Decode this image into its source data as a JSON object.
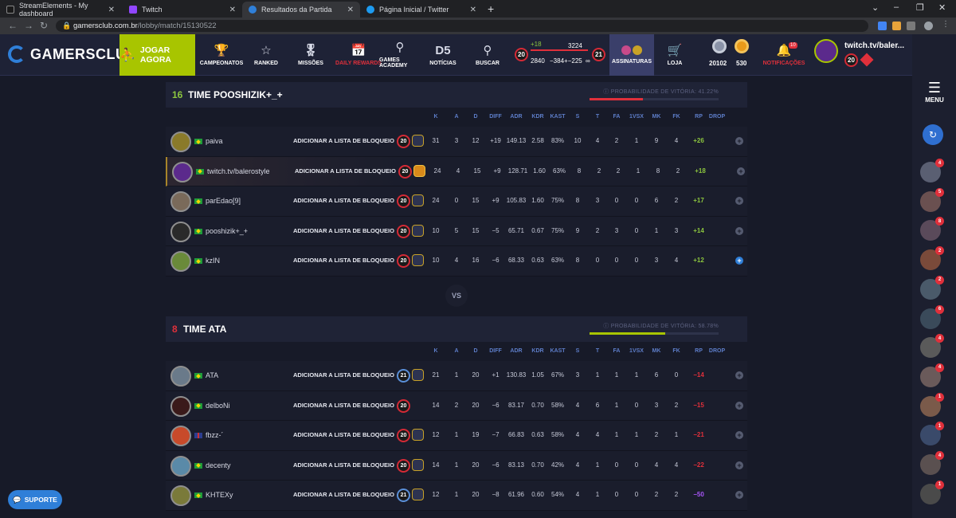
{
  "browser": {
    "tabs": [
      {
        "title": "StreamElements - My dashboard",
        "active": false
      },
      {
        "title": "Twitch",
        "active": false
      },
      {
        "title": "Resultados da Partida",
        "active": true
      },
      {
        "title": "Página Inicial / Twitter",
        "active": false
      }
    ],
    "url_host": "gamersclub.com.br",
    "url_path": "/lobby/match/15130522"
  },
  "header": {
    "logo": "GAMERSCLUB",
    "play": "JOGAR AGORA",
    "nav": [
      "CAMPEONATOS",
      "RANKED",
      "MISSÕES",
      "DAILY REWARDS",
      "GAMES ACADEMY",
      "NOTÍCIAS",
      "BUSCAR"
    ],
    "level": {
      "left": "20",
      "right": "21",
      "gain": "+18",
      "current": "2840",
      "target": "3224",
      "range": "−384+−225",
      "infinity": "∞"
    },
    "subs": "ASSINATURAS",
    "shop": "LOJA",
    "coins1": "20102",
    "coins2": "530",
    "notif": "NOTIFICAÇÕES",
    "notif_badge": "10",
    "user": {
      "name": "twitch.tv/baler...",
      "level": "20"
    }
  },
  "sidebar": {
    "menu": "MENU",
    "friend_counts": [
      "4",
      "5",
      "8",
      "2",
      "2",
      "6",
      "4",
      "4",
      "1",
      "1",
      "4",
      "1"
    ]
  },
  "columns": [
    "K",
    "A",
    "D",
    "DIFF",
    "ADR",
    "KDR",
    "KAST",
    "S",
    "T",
    "FA",
    "1VSX",
    "MK",
    "FK",
    "RP",
    "DROP"
  ],
  "block_label": "ADICIONAR A LISTA DE BLOQUEIO",
  "vs": "VS",
  "support": "SUPORTE",
  "team1": {
    "score": "16",
    "name": "TIME POOSHIZIK+_+",
    "prob_label": "PROBABILIDADE DE VITÓRIA: 41.22%",
    "prob": 0.4122,
    "players": [
      {
        "name": "paiva",
        "lvl": "20",
        "stats": [
          "31",
          "3",
          "12",
          "+19",
          "149.13",
          "2.58",
          "83%",
          "10",
          "4",
          "2",
          "1",
          "9",
          "4",
          "+26"
        ],
        "drop": false
      },
      {
        "name": "twitch.tv/balerostyle",
        "lvl": "20",
        "stats": [
          "24",
          "4",
          "15",
          "+9",
          "128.71",
          "1.60",
          "63%",
          "8",
          "2",
          "2",
          "1",
          "8",
          "2",
          "+18"
        ],
        "drop": false
      },
      {
        "name": "parEdao[9]",
        "lvl": "20",
        "stats": [
          "24",
          "0",
          "15",
          "+9",
          "105.83",
          "1.60",
          "75%",
          "8",
          "3",
          "0",
          "0",
          "6",
          "2",
          "+17"
        ],
        "drop": false
      },
      {
        "name": "pooshizik+_+",
        "lvl": "20",
        "stats": [
          "10",
          "5",
          "15",
          "−5",
          "65.71",
          "0.67",
          "75%",
          "9",
          "2",
          "3",
          "0",
          "1",
          "3",
          "+14"
        ],
        "drop": false
      },
      {
        "name": "kzIN",
        "lvl": "20",
        "stats": [
          "10",
          "4",
          "16",
          "−6",
          "68.33",
          "0.63",
          "63%",
          "8",
          "0",
          "0",
          "0",
          "3",
          "4",
          "+12"
        ],
        "drop": true
      }
    ]
  },
  "team2": {
    "score": "8",
    "name": "TIME ATA",
    "prob_label": "PROBABILIDADE DE VITÓRIA: 58.78%",
    "prob": 0.5878,
    "players": [
      {
        "name": "ATA",
        "lvl": "21",
        "stats": [
          "21",
          "1",
          "20",
          "+1",
          "130.83",
          "1.05",
          "67%",
          "3",
          "1",
          "1",
          "1",
          "6",
          "0",
          "−14"
        ],
        "drop": false
      },
      {
        "name": "delboNi",
        "lvl": "20",
        "stats": [
          "14",
          "2",
          "20",
          "−6",
          "83.17",
          "0.70",
          "58%",
          "4",
          "6",
          "1",
          "0",
          "3",
          "2",
          "−15"
        ],
        "drop": false
      },
      {
        "name": "fbzz-´",
        "lvl": "20",
        "stats": [
          "12",
          "1",
          "19",
          "−7",
          "66.83",
          "0.63",
          "58%",
          "4",
          "4",
          "1",
          "1",
          "2",
          "1",
          "−21"
        ],
        "drop": false
      },
      {
        "name": "decenty",
        "lvl": "20",
        "stats": [
          "14",
          "1",
          "20",
          "−6",
          "83.13",
          "0.70",
          "42%",
          "4",
          "1",
          "0",
          "0",
          "4",
          "4",
          "−22"
        ],
        "drop": false
      },
      {
        "name": "KHTEXy",
        "lvl": "21",
        "stats": [
          "12",
          "1",
          "20",
          "−8",
          "61.96",
          "0.60",
          "54%",
          "4",
          "1",
          "0",
          "0",
          "2",
          "2",
          "−50"
        ],
        "drop": false
      }
    ]
  },
  "colors": {
    "accent_green": "#a8c500",
    "red": "#e0303b",
    "blue": "#2f7fd8",
    "rp_pos": "#8cc63f",
    "rp_neg": "#e0303b",
    "rp_worst": "#a855f7"
  }
}
